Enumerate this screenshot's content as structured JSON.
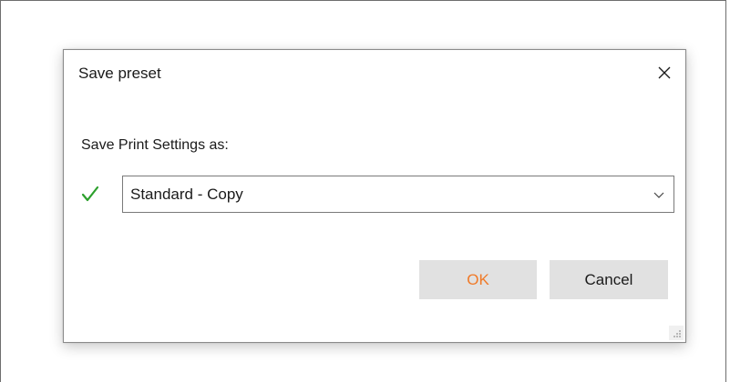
{
  "dialog": {
    "title": "Save preset",
    "prompt_label": "Save Print Settings as:",
    "preset_name": "Standard - Copy",
    "ok_label": "OK",
    "cancel_label": "Cancel"
  },
  "icons": {
    "close": "close-icon",
    "check": "check-icon",
    "chevron": "chevron-down-icon",
    "grip": "resize-grip-icon"
  },
  "colors": {
    "check": "#2ca02c",
    "ok_text": "#f07a28",
    "button_bg": "#e1e1e1"
  }
}
